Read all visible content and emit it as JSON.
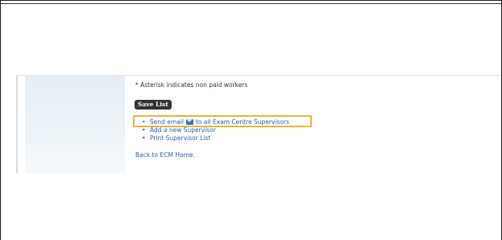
{
  "page": {
    "asterisk_note": "* Asterisk indicates non paid workers",
    "save_button": "Save List",
    "links": [
      {
        "label_pre": "Send email",
        "icon": "envelope-icon",
        "label_post": "to all Exam Centre Supervisors"
      },
      {
        "label": "Add a new Supervisor"
      },
      {
        "label": "Print Supervisor List"
      }
    ],
    "back_link": "Back to ECM Home."
  },
  "colors": {
    "link": "#2a5db0",
    "highlight_border": "#e7b33d",
    "button_bg": "#333333"
  }
}
